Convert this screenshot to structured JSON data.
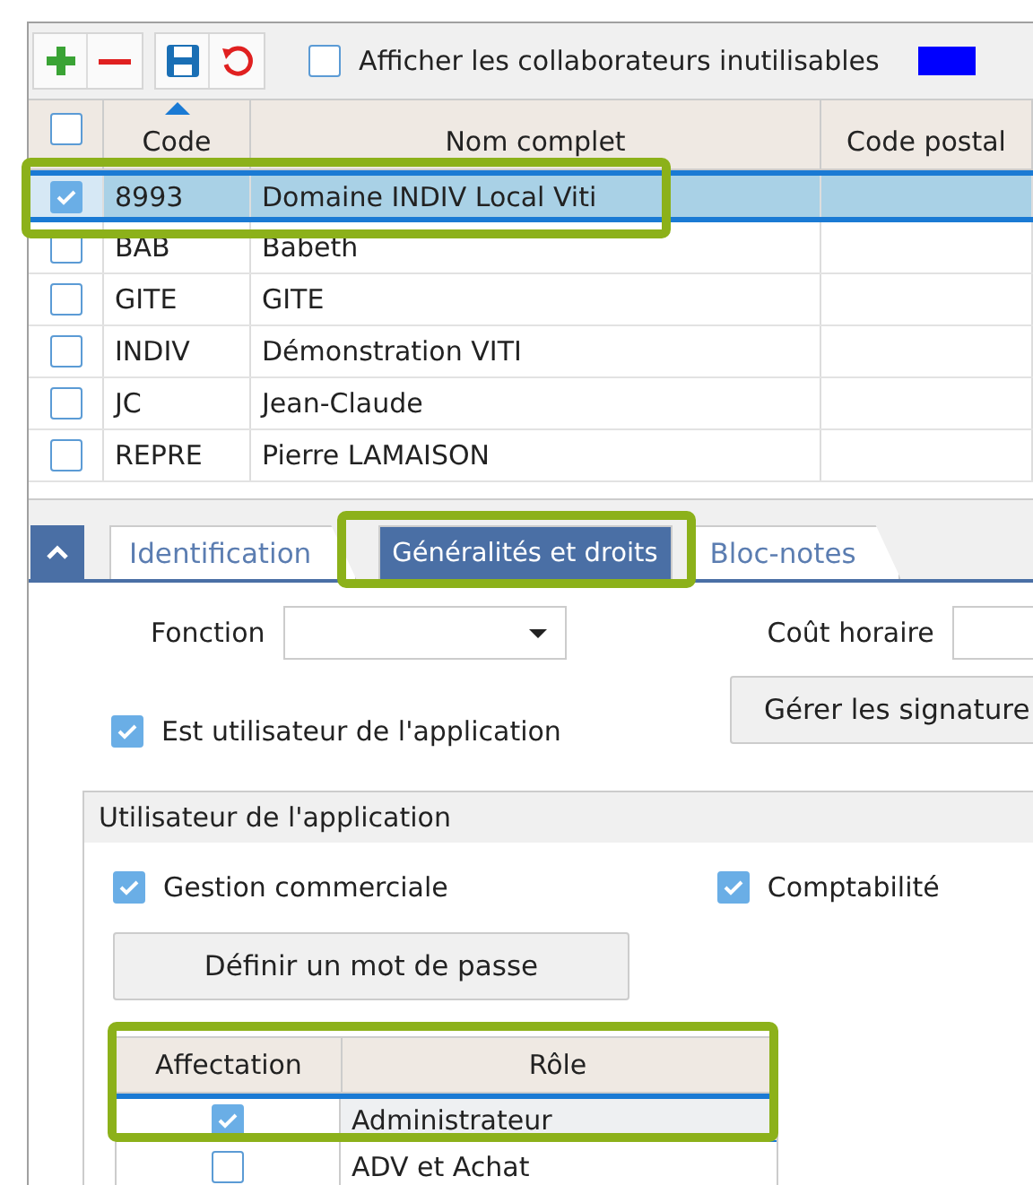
{
  "toolbar": {
    "show_unusable": {
      "label": "Afficher les collaborateurs inutilisables",
      "checked": false
    }
  },
  "grid": {
    "columns": [
      "Code",
      "Nom complet",
      "Code postal"
    ],
    "all_checked": false,
    "rows": [
      {
        "code": "8993",
        "name": "Domaine INDIV Local Viti",
        "checked": true,
        "selected": true
      },
      {
        "code": "BAB",
        "name": "Babeth",
        "checked": false,
        "selected": false
      },
      {
        "code": "GITE",
        "name": "GITE",
        "checked": false,
        "selected": false
      },
      {
        "code": "INDIV",
        "name": "Démonstration VITI",
        "checked": false,
        "selected": false
      },
      {
        "code": "JC",
        "name": "Jean-Claude",
        "checked": false,
        "selected": false
      },
      {
        "code": "REPRE",
        "name": "Pierre LAMAISON",
        "checked": false,
        "selected": false
      }
    ]
  },
  "tabs": [
    {
      "label": "Identification",
      "selected": false
    },
    {
      "label": "Généralités et droits",
      "selected": true
    },
    {
      "label": "Bloc-notes",
      "selected": false
    }
  ],
  "form": {
    "fonction_label": "Fonction",
    "cout_label": "Coût horaire",
    "signatures_button": "Gérer les signature",
    "is_user": {
      "label": "Est utilisateur de l'application",
      "checked": true
    },
    "group": {
      "title": "Utilisateur de l'application",
      "modules": [
        {
          "label": "Gestion commerciale",
          "checked": true
        },
        {
          "label": "Comptabilité",
          "checked": true
        }
      ],
      "password_button": "Définir un mot de passe",
      "roles": {
        "columns": [
          "Affectation",
          "Rôle"
        ],
        "rows": [
          {
            "assigned": true,
            "role": "Administrateur",
            "selected": true
          },
          {
            "assigned": false,
            "role": "ADV et Achat",
            "selected": false
          }
        ]
      }
    }
  }
}
